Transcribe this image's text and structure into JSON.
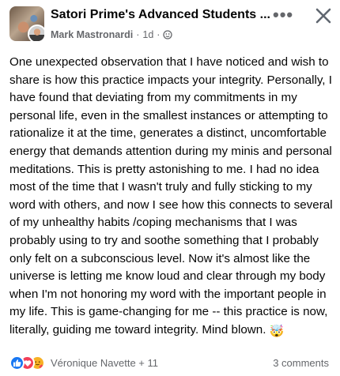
{
  "header": {
    "group_name": "Satori Prime's Advanced Students ...",
    "author": "Mark Mastronardi",
    "time": "1d",
    "separator": "·",
    "privacy_icon": "globe-icon",
    "more_label": "•••",
    "close_icon": "close-icon"
  },
  "post": {
    "text": "One unexpected observation that I have noticed and wish to share is how this practice impacts your integrity. Personally, I have found that deviating from my commitments in my personal life, even in the smallest instances or attempting to rationalize it at the time, generates a distinct, uncomfortable energy that demands attention during my minis and personal meditations. This is pretty astonishing to me. I had no idea most of the time that I wasn't truly and fully sticking to my word with others, and now I see how this connects to several of my unhealthy habits /coping mechanisms that I was probably using to try and soothe something that I probably only felt on a subconscious level. Now it's almost like the universe is letting me know loud and clear through my body when I'm not honoring my word with the important people in my life. This is game-changing for me -- this practice is now, literally, guiding me toward integrity. Mind blown. ",
    "trailing_emoji": "🤯"
  },
  "footer": {
    "reaction_icons": [
      "like-icon",
      "love-icon",
      "care-icon"
    ],
    "reactors": "Véronique Navette + 11",
    "comments": "3 comments"
  },
  "colors": {
    "like": "#1877f2",
    "love": "#f33e58",
    "care": "#f7b125",
    "secondary_text": "#65676b"
  }
}
